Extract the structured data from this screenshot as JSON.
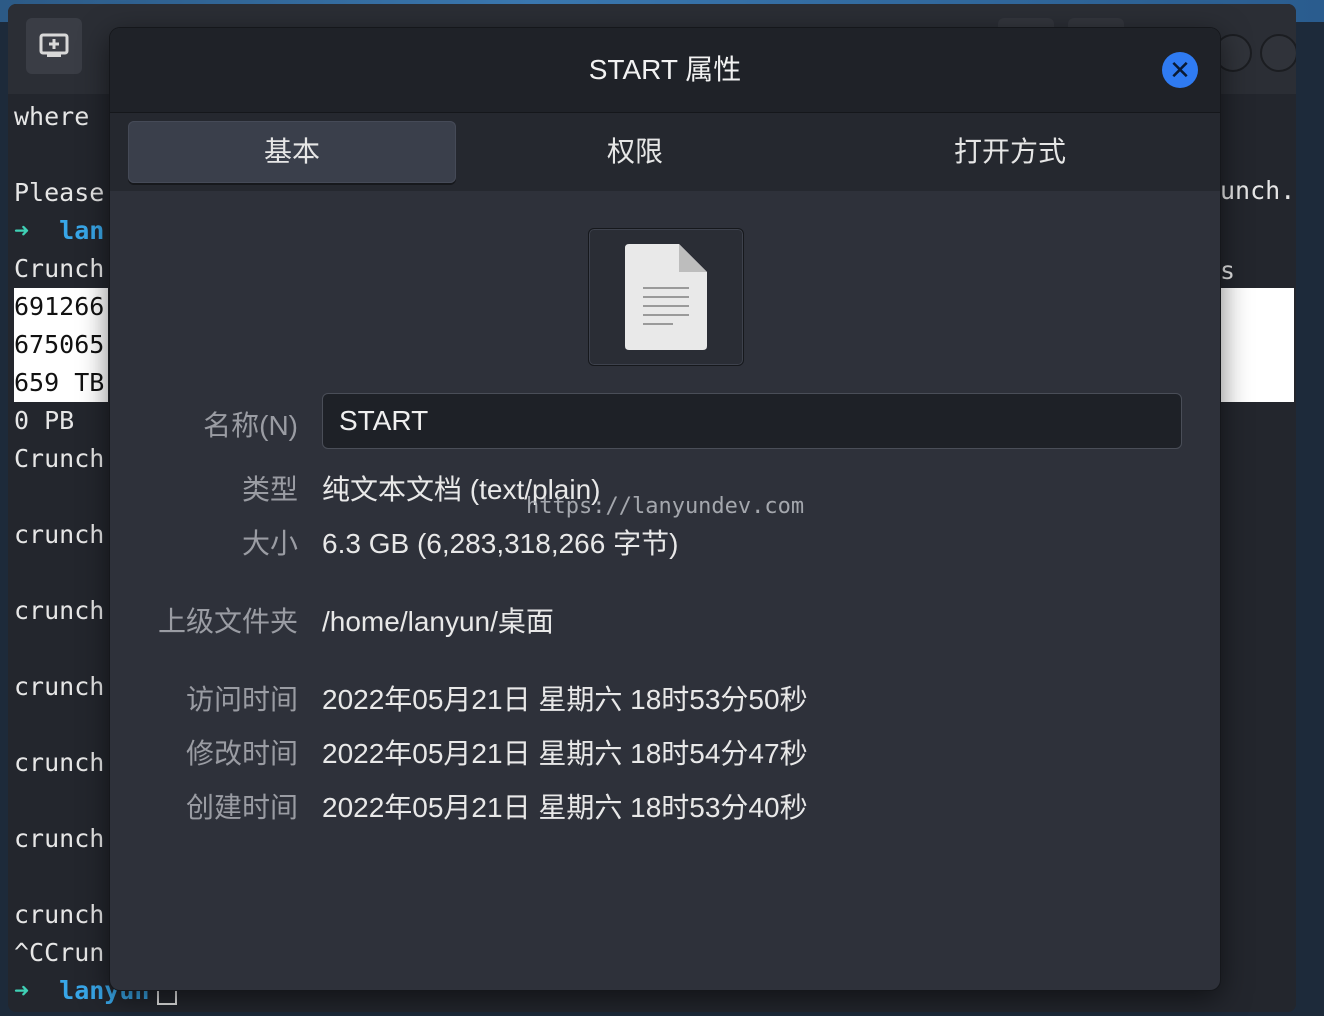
{
  "terminal": {
    "lines": [
      {
        "text": "where ",
        "highlight": false
      },
      {
        "text": "",
        "highlight": false
      },
      {
        "text": "Please",
        "highlight": false
      },
      {
        "prompt": true,
        "arrow": "➜",
        "cwd": "lan"
      },
      {
        "text": "Crunch",
        "highlight": false
      },
      {
        "text": "691266",
        "highlight": true
      },
      {
        "text": "675065",
        "highlight": true
      },
      {
        "text": "659 TB",
        "highlight": true
      },
      {
        "text": "0 PB",
        "highlight": false
      },
      {
        "text": "Crunch",
        "highlight": false
      },
      {
        "text": "",
        "highlight": false
      },
      {
        "text": "crunch",
        "highlight": false
      },
      {
        "text": "",
        "highlight": false
      },
      {
        "text": "crunch",
        "highlight": false
      },
      {
        "text": "",
        "highlight": false
      },
      {
        "text": "crunch",
        "highlight": false
      },
      {
        "text": "",
        "highlight": false
      },
      {
        "text": "crunch",
        "highlight": false
      },
      {
        "text": "",
        "highlight": false
      },
      {
        "text": "crunch",
        "highlight": false
      },
      {
        "text": "",
        "highlight": false
      },
      {
        "text": "crunch",
        "highlight": false
      },
      {
        "text": "^CCrun",
        "highlight": false
      },
      {
        "prompt": true,
        "arrow": "➜",
        "cwd": "lanyun",
        "cursor": true
      }
    ],
    "right_text": "unch.",
    "right_text_2": "s"
  },
  "dialog": {
    "title": "START 属性",
    "close_icon": "close-icon",
    "tabs": [
      {
        "label": "基本",
        "active": true
      },
      {
        "label": "权限",
        "active": false
      },
      {
        "label": "打开方式",
        "active": false
      }
    ],
    "file_icon": "text-document-icon",
    "fields": {
      "name_label": "名称(N)",
      "name_value": "START",
      "type_label": "类型",
      "type_value": "纯文本文档 (text/plain)",
      "size_label": "大小",
      "size_value": "6.3 GB (6,283,318,266 字节)",
      "parent_label": "上级文件夹",
      "parent_value": "/home/lanyun/桌面",
      "accessed_label": "访问时间",
      "accessed_value": "2022年05月21日 星期六 18时53分50秒",
      "modified_label": "修改时间",
      "modified_value": "2022年05月21日 星期六 18时54分47秒",
      "created_label": "创建时间",
      "created_value": "2022年05月21日 星期六 18时53分40秒"
    }
  },
  "watermark": "https://lanyundev.com",
  "colors": {
    "accent": "#2f7bf2",
    "prompt_arrow": "#3fd0b5",
    "prompt_cwd": "#38a6e8"
  }
}
